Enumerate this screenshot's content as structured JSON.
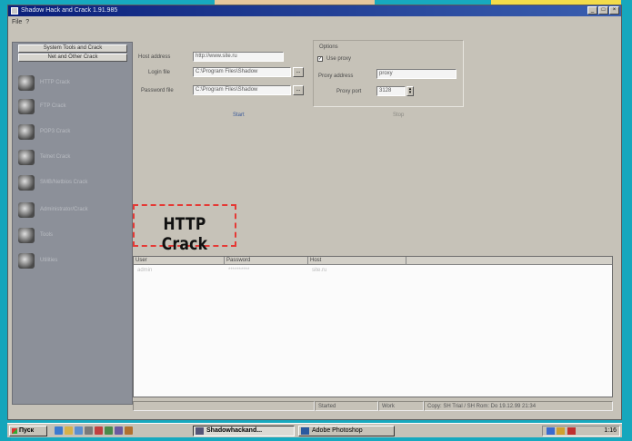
{
  "window": {
    "title": "Shadow Hack and Crack 1.91.985",
    "controls": [
      "_",
      "□",
      "×"
    ]
  },
  "menu": {
    "items": [
      "File",
      "?"
    ]
  },
  "sidebar": {
    "tabs": [
      "System Tools and Crack",
      "Net and Other Crack"
    ],
    "items": [
      {
        "label": "HTTP Crack",
        "icon": "globe-icon"
      },
      {
        "label": "FTP Crack",
        "icon": "folder-icon"
      },
      {
        "label": "POP3 Crack",
        "icon": "mail-icon"
      },
      {
        "label": "Telnet Crack",
        "icon": "terminal-icon"
      },
      {
        "label": "SMB/Netbios Crack",
        "icon": "network-icon"
      },
      {
        "label": "Administrator/Crack",
        "icon": "tools-icon"
      },
      {
        "label": "Tools",
        "icon": "tools-icon"
      },
      {
        "label": "Utilities",
        "icon": "tools-icon"
      }
    ]
  },
  "form": {
    "host_label": "Host address",
    "host_value": "http://www.site.ru",
    "login_file_label": "Login file",
    "login_file_value": "C:\\Program Files\\Shadow",
    "password_file_label": "Password file",
    "password_file_value": "C:\\Program Files\\Shadow",
    "browse": "..."
  },
  "options": {
    "title": "Options",
    "use_proxy_label": "Use proxy",
    "use_proxy_checked": true,
    "proxy_address_label": "Proxy address",
    "proxy_address_value": "proxy",
    "proxy_port_label": "Proxy port",
    "proxy_port_value": "3128"
  },
  "actions": {
    "start": "Start",
    "stop": "Stop"
  },
  "highlight": {
    "text": "HTTP Crack"
  },
  "results": {
    "columns": [
      "User",
      "Password",
      "Host"
    ],
    "row": [
      "admin",
      "**********",
      "site.ru"
    ]
  },
  "status": {
    "segments": [
      "Started",
      "Work",
      "Copy: SH Trial / SH Rom: Do 19.12.99 21:34"
    ]
  },
  "taskbar": {
    "start_label": "Пуск",
    "tasks": [
      {
        "label": "Shadowhackand...",
        "active": true
      },
      {
        "label": "Adobe Photoshop",
        "active": false
      }
    ],
    "clock": "1:16"
  }
}
